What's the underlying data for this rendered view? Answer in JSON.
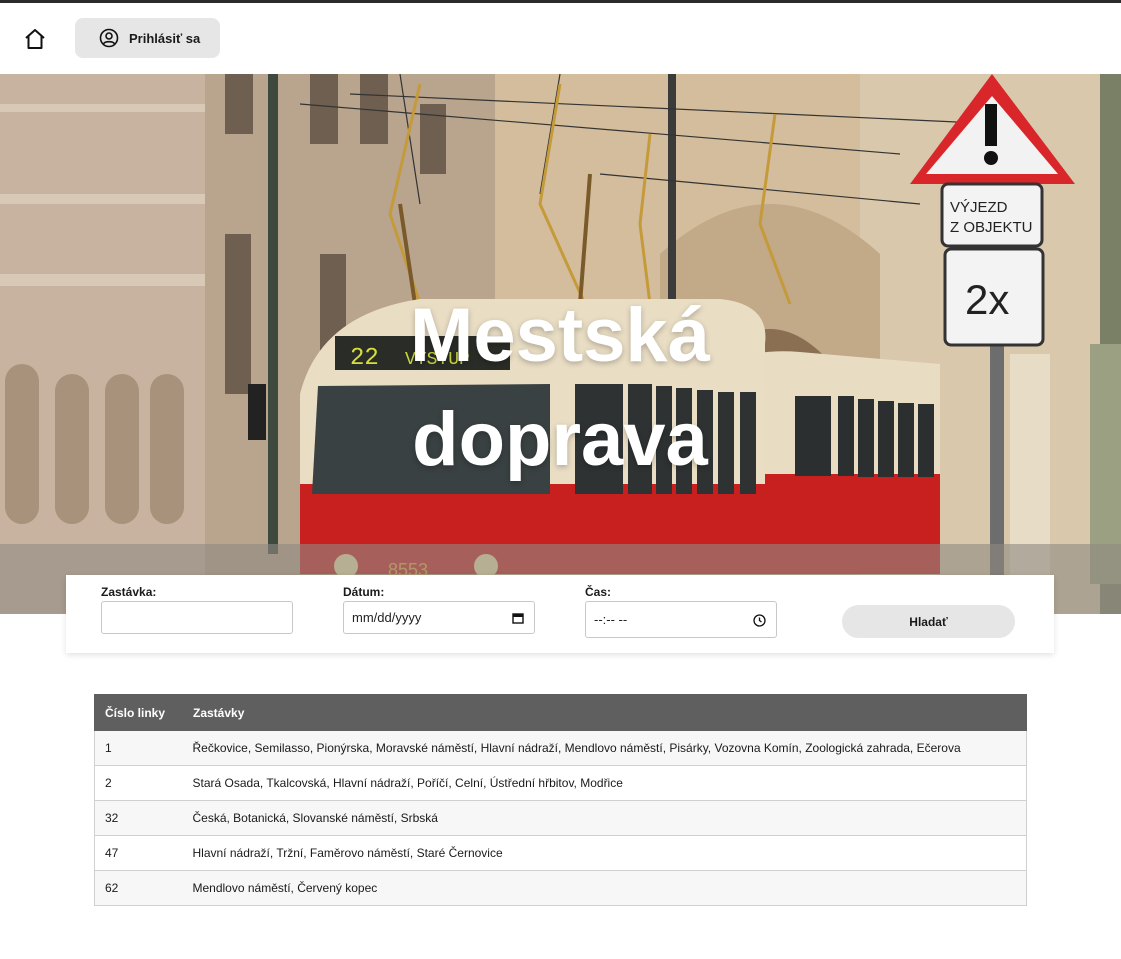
{
  "nav": {
    "home_icon": "home-icon",
    "login_icon": "user-circle-icon",
    "login_label": "Prihlásiť sa"
  },
  "hero": {
    "title_line1": "Mestská",
    "title_line2": "doprava"
  },
  "search": {
    "stop_label": "Zastávka:",
    "stop_value": "",
    "date_label": "Dátum:",
    "date_placeholder": "mm/dd/yyyy",
    "time_label": "Čas:",
    "time_placeholder": "--:-- --",
    "button_label": "Hladať"
  },
  "table": {
    "headers": [
      "Číslo linky",
      "Zastávky"
    ],
    "rows": [
      {
        "line": "1",
        "stops": "Řečkovice, Semilasso, Pionýrska, Moravské náměstí, Hlavní nádraží, Mendlovo náměstí, Pisárky, Vozovna Komín, Zoologická zahrada, Ečerova"
      },
      {
        "line": "2",
        "stops": "Stará Osada, Tkalcovská, Hlavní nádraží, Poříčí, Celní, Ústřední hřbitov, Modřice"
      },
      {
        "line": "32",
        "stops": "Česká, Botanická, Slovanské náměstí, Srbská"
      },
      {
        "line": "47",
        "stops": "Hlavní nádraží, Tržní, Faměrovo náměstí, Staré Černovice"
      },
      {
        "line": "62",
        "stops": "Mendlovo náměstí, Červený kopec"
      }
    ]
  },
  "colors": {
    "table_header_bg": "#5f5f5f",
    "button_bg": "#e6e6e6",
    "tram_red": "#c8201e"
  }
}
